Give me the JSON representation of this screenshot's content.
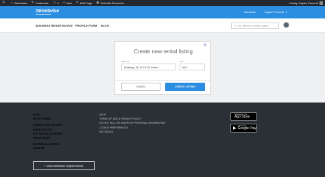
{
  "admin_bar": {
    "wp_logo": "wordpress-icon",
    "site_name": "Streetwise",
    "customize": "Customize",
    "comments_count": "0",
    "new_label": "New",
    "edit_page": "Edit Page",
    "edit_elementor": "Edit with Elementor",
    "howdy": "Howdy, Kaylee Prescott"
  },
  "header": {
    "logo_text": "Streetwise",
    "advertise": "Advertise",
    "user_name": "Kaylee Prescott"
  },
  "nav": {
    "items": [
      "BUSINESS REGISTRATION",
      "PROFILE FORM",
      "BLOG"
    ],
    "search_placeholder": "e.g. address, building, agent"
  },
  "modal": {
    "title": "Create new rental listing",
    "close_symbol": "✕",
    "address_label": "Address",
    "address_value": "Building: 35-15 147th Street",
    "unit_label": "Unit",
    "unit_value": "#4E",
    "cancel_label": "CANCEL",
    "create_label": "CREATE LISTING"
  },
  "footer": {
    "col1_group1": [
      "BLOG",
      "WE'RE HIRING!"
    ],
    "col1_group2": [
      "SUBMIT YOUR LISTINGS",
      "WORK WITH US",
      "NYC RENTAL NETWORK",
      "PRESS ROOM"
    ],
    "col1_group3": [
      "BROWSE ALL HOMES",
      "NEAR ME"
    ],
    "col2": [
      "HELP",
      "TERMS OF USE & PRIVACY POLICY",
      "DO NOT SELL OR SHARE MY PERSONAL INFORMATION",
      "COOKIE PREFERENCES",
      "AD CHOICE"
    ],
    "neighborhoods_button": "+ show streetwise neighborhoods",
    "app_store": {
      "small": "Download on the",
      "big": "App Store"
    },
    "google_play": {
      "small": "GET IT ON",
      "big": "Google Play"
    }
  },
  "colors": {
    "brand_blue": "#2b8ee0",
    "footer_bg": "#2a3035",
    "admin_bar_bg": "#23282d"
  }
}
